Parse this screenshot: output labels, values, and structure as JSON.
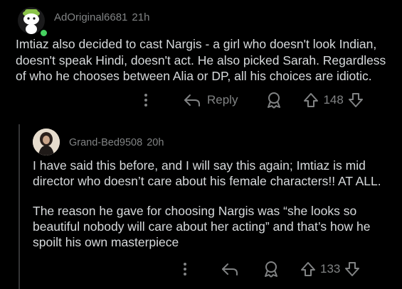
{
  "comment": {
    "username": "AdOriginal6681",
    "time": "21h",
    "text": "Imtiaz also decided to cast Nargis - a girl who doesn't look Indian, doesn't speak Hindi, doesn't act. He also picked Sarah. Regardless of who he chooses between Alia or DP, all his choices are idiotic.",
    "reply_label": "Reply",
    "vote_count": "148",
    "online_status_color": "#46d160"
  },
  "reply": {
    "username": "Grand-Bed9508",
    "time": "20h",
    "paragraphs": [
      "I have said this before, and I will say this again; Imtiaz is mid director who doesn’t care about his female characters!! AT ALL.",
      "The reason he gave for choosing Nargis was “she looks so beautiful nobody will care about her acting” and that’s how he spoilt his own masterpiece"
    ],
    "vote_count": "133"
  },
  "icons": {
    "more": "kebab-vertical-icon",
    "reply": "reply-arrow-icon",
    "award": "award-icon",
    "upvote": "upvote-arrow-icon",
    "downvote": "downvote-arrow-icon"
  },
  "colors": {
    "background": "#000000",
    "text": "#d7dadc",
    "muted": "#818384",
    "thread_line": "#343536"
  }
}
